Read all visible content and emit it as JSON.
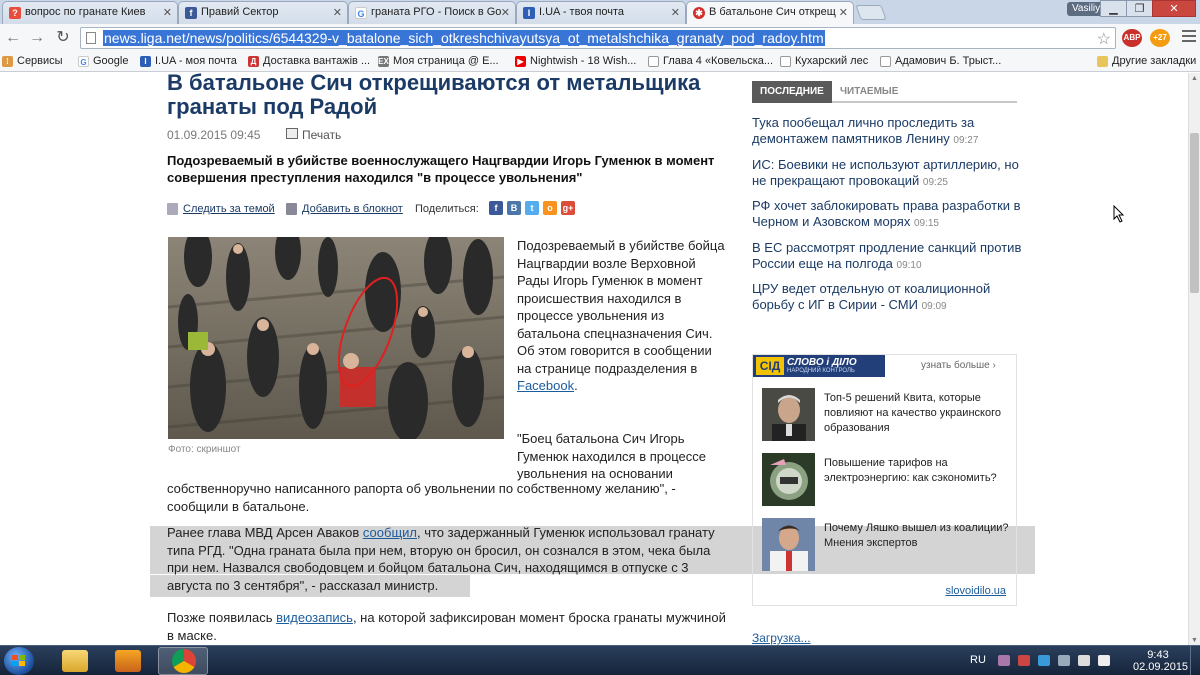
{
  "tabs": [
    {
      "label": "вопрос по гранате Киев",
      "favicon": "yandex-answers-icon",
      "color": "#e74c3c"
    },
    {
      "label": "Правий Сектор",
      "favicon": "facebook-icon",
      "color": "#3b5998"
    },
    {
      "label": "граната РГО - Поиск в Go",
      "favicon": "google-icon",
      "color": "#4285f4"
    },
    {
      "label": "I.UA - твоя почта",
      "favicon": "iua-icon",
      "color": "#2d5fb5"
    },
    {
      "label": "В батальоне Сич открещ",
      "favicon": "liga-icon",
      "color": "#d0312d",
      "active": true
    }
  ],
  "window": {
    "user": "Vasiliy"
  },
  "toolbar": {
    "url": "news.liga.net/news/politics/6544329-v_batalone_sich_otkreshchivayutsya_ot_metalshchika_granaty_pod_radoy.htm",
    "ext1_badge": "ABP 10",
    "ext2_badge": "+27"
  },
  "bookmarks": {
    "items": [
      {
        "label": "Сервисы",
        "icon": "apps-grid-icon",
        "color": "#d94"
      },
      {
        "label": "Google",
        "icon": "google-icon",
        "color": "#4285f4"
      },
      {
        "label": "I.UA - моя почта",
        "icon": "iua-icon",
        "color": "#2d5fb5"
      },
      {
        "label": "Доставка вантажів ...",
        "icon": "delivery-icon",
        "color": "#c33"
      },
      {
        "label": "Моя страница @ E...",
        "icon": "ex-icon",
        "color": "#777"
      },
      {
        "label": "Nightwish - 18 Wish...",
        "icon": "youtube-icon",
        "color": "#e00"
      },
      {
        "label": "Глава 4 «Ковельска...",
        "icon": "page-icon",
        "color": "#999"
      },
      {
        "label": "Кухарский лес",
        "icon": "page-icon",
        "color": "#999"
      },
      {
        "label": "Адамович Б. Трыст...",
        "icon": "page-icon",
        "color": "#999"
      }
    ],
    "other": "Другие закладки"
  },
  "article": {
    "title": "В батальоне Сич открещиваются от метальщика гранаты под Радой",
    "date": "01.09.2015 09:45",
    "print": "Печать",
    "lead": "Подозреваемый в убийстве военнослужащего Нацгвардии Игорь Гуменюк в момент совершения преступления находился \"в процессе увольнения\"",
    "follow": "Следить за темой",
    "notebook": "Добавить в блокнот",
    "share": "Поделиться:",
    "photo_caption": "Фото: скриншот",
    "p1": "Подозреваемый в убийстве бойца Нацгвардии возле Верховной Рады Игорь Гуменюк в момент происшествия находился в процессе увольнения из батальона спецназначения Сич. Об этом говорится в сообщении на странице подразделения в ",
    "p1_link": "Facebook",
    "p1_end": ".",
    "p2a": "\"Боец батальона Сич Игорь Гуменюк находился в процессе увольнения на основании",
    "p2b": "собственноручно написанного рапорта об увольнении по собственному желанию\", - сообщили в батальоне.",
    "p3_start": "Ранее глава МВД Арсен Аваков ",
    "p3_link": "сообщил",
    "p3_rest": ", что задержанный Гуменюк использовал гранату типа РГД. \"Одна граната была при нем, вторую он бросил, он сознался в этом, чека была при нем. Назвался свободовцем и бойцом батальона Сич, находящимся в отпуске с 3 августа по 3 сентября\", - рассказал министр.",
    "p4_start": "Позже появилась ",
    "p4_link": "видеозапись",
    "p4_rest": ", на которой зафиксирован момент броска гранаты мужчиной в маске."
  },
  "sidebar": {
    "tab_latest": "ПОСЛЕДНИЕ",
    "tab_read": "ЧИТАЕМЫЕ",
    "news": [
      {
        "title": "Тука пообещал лично проследить за демонтажем памятников Ленину",
        "time": "09:27"
      },
      {
        "title": "ИС: Боевики не используют артиллерию, но не прекращают провокаций",
        "time": "09:25"
      },
      {
        "title": "РФ хочет заблокировать права разработки в Черном и Азовском морях",
        "time": "09:15"
      },
      {
        "title": "В ЕС рассмотрят продление санкций против России еще на полгода",
        "time": "09:10"
      },
      {
        "title": "ЦРУ ведет отдельную от коалиционной борьбу с ИГ в Сирии - СМИ",
        "time": "09:09"
      }
    ],
    "partner": {
      "logo_badge": "СІД",
      "logo_name": "СЛОВО і ДІЛО",
      "logo_sub": "НАРОДНИЙ КОНТРОЛЬ",
      "more": "узнать больше ›",
      "items": [
        "Топ-5 решений Квита, которые повлияют на качество украинского образования",
        "Повышение тарифов на электроэнергию: как сэкономить?",
        "Почему Ляшко вышел из коалиции? Мнения экспертов"
      ],
      "site": "slovoidilo.ua"
    },
    "loading": "Загрузка..."
  },
  "taskbar": {
    "lang": "RU",
    "time": "9:43",
    "date": "02.09.2015"
  }
}
